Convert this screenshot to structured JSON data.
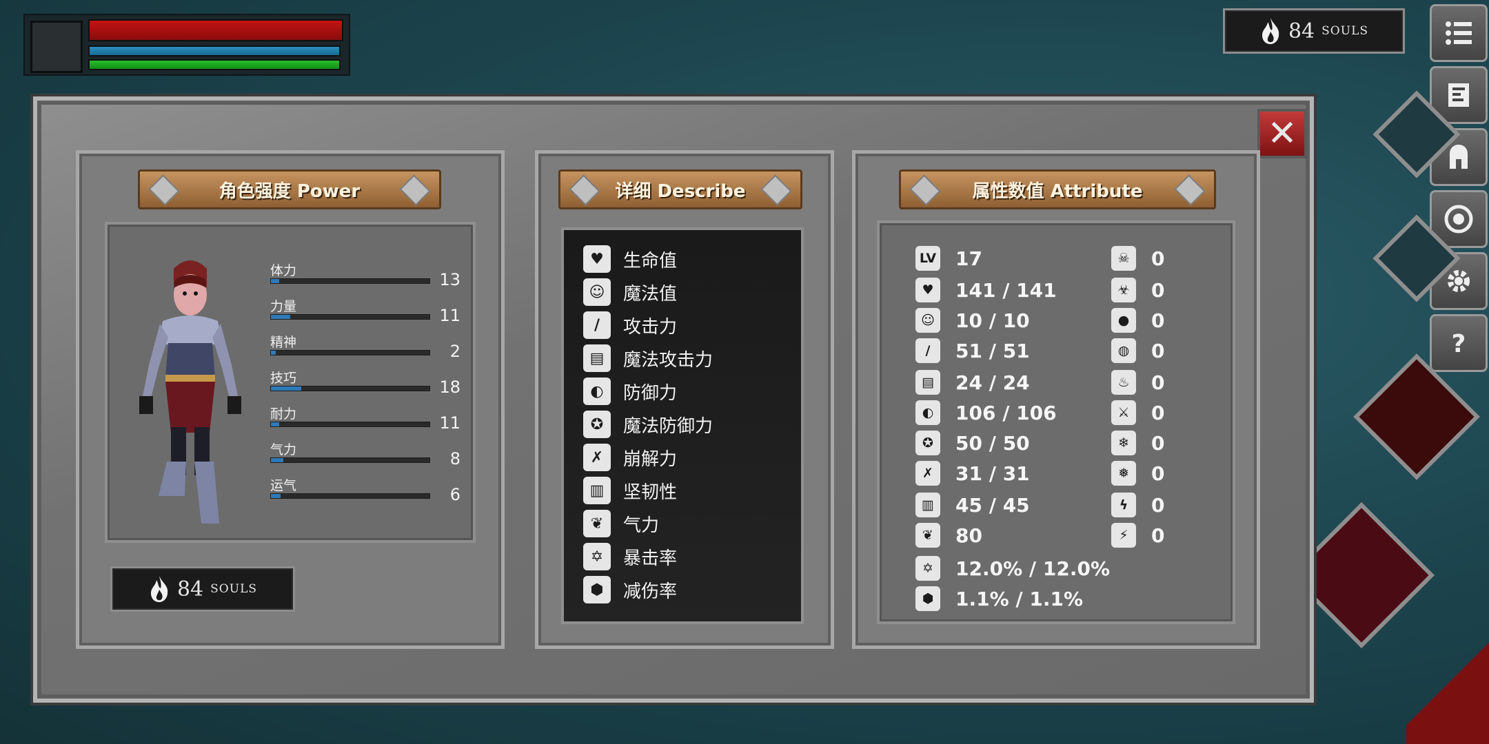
{
  "hud": {
    "souls_count": "84",
    "souls_label": "SOULS"
  },
  "panels": {
    "power_title": "角色强度 Power",
    "describe_title": "详细 Describe",
    "attribute_title": "属性数值 Attribute"
  },
  "stats": [
    {
      "name": "体力",
      "value": "13",
      "fill": 0.05
    },
    {
      "name": "力量",
      "value": "11",
      "fill": 0.12
    },
    {
      "name": "精神",
      "value": "2",
      "fill": 0.03
    },
    {
      "name": "技巧",
      "value": "18",
      "fill": 0.19
    },
    {
      "name": "耐力",
      "value": "11",
      "fill": 0.05
    },
    {
      "name": "气力",
      "value": "8",
      "fill": 0.08
    },
    {
      "name": "运气",
      "value": "6",
      "fill": 0.06
    }
  ],
  "describe": [
    {
      "icon": "heart-icon",
      "label": "生命值"
    },
    {
      "icon": "head-icon",
      "label": "魔法值"
    },
    {
      "icon": "sword-icon",
      "label": "攻击力"
    },
    {
      "icon": "spellbook-icon",
      "label": "魔法攻击力"
    },
    {
      "icon": "shield-icon",
      "label": "防御力"
    },
    {
      "icon": "magic-shield-icon",
      "label": "魔法防御力"
    },
    {
      "icon": "break-icon",
      "label": "崩解力"
    },
    {
      "icon": "helmet-icon",
      "label": "坚韧性"
    },
    {
      "icon": "lungs-icon",
      "label": "气力"
    },
    {
      "icon": "crit-star-icon",
      "label": "暴击率"
    },
    {
      "icon": "damage-reduction-icon",
      "label": "减伤率"
    }
  ],
  "attributes": {
    "level_label": "LV",
    "level": "17",
    "values": [
      "141 / 141",
      "10 / 10",
      "51 / 51",
      "24 / 24",
      "106 / 106",
      "50 / 50",
      "31 / 31",
      "45 / 45",
      "80",
      "12.0% / 12.0%",
      "1.1% / 1.1%"
    ],
    "resistances": [
      {
        "icon": "skull-icon",
        "value": "0"
      },
      {
        "icon": "poison-icon",
        "value": "0"
      },
      {
        "icon": "blood-drop-icon",
        "value": "0"
      },
      {
        "icon": "bleed-icon",
        "value": "0"
      },
      {
        "icon": "fire-icon",
        "value": "0"
      },
      {
        "icon": "fire-resist-icon",
        "value": "0"
      },
      {
        "icon": "frost-icon",
        "value": "0"
      },
      {
        "icon": "frost-resist-icon",
        "value": "0"
      },
      {
        "icon": "lightning-icon",
        "value": "0"
      },
      {
        "icon": "lightning-resist-icon",
        "value": "0"
      }
    ]
  },
  "colors": {
    "hp": "#b01010",
    "mp": "#1f7fae",
    "stamina": "#1faa22",
    "close": "#a82222"
  }
}
